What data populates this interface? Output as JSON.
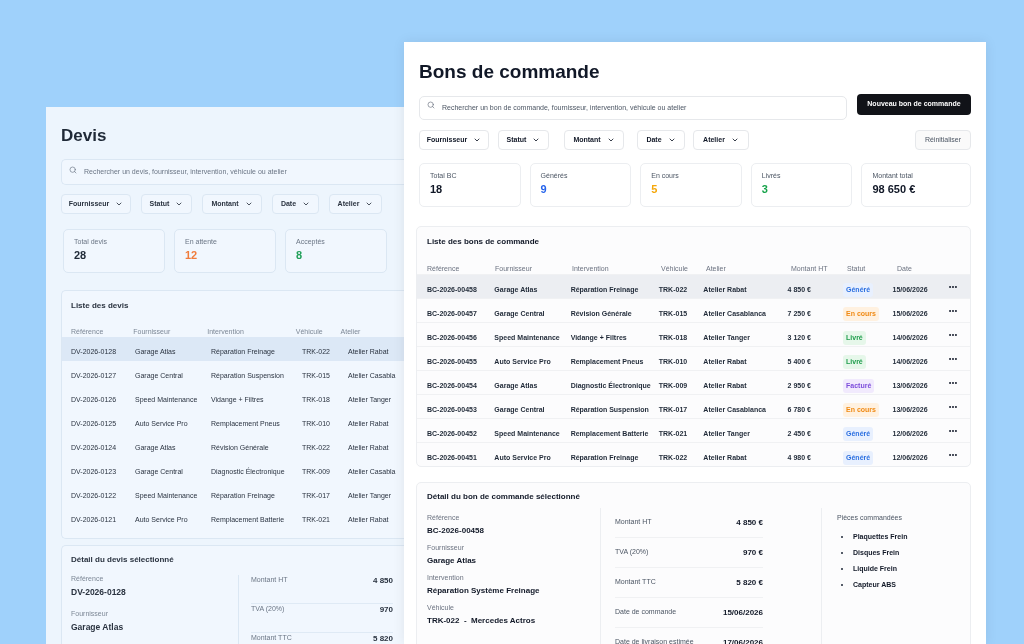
{
  "devis_window": {
    "title": "Devis",
    "search": {
      "placeholder": "Rechercher un devis, fournisseur, intervention, véhicule ou atelier"
    },
    "filters": [
      "Fournisseur",
      "Statut",
      "Montant",
      "Date",
      "Atelier"
    ],
    "stats": [
      {
        "label": "Total devis",
        "value": "28",
        "color": "#1f2937"
      },
      {
        "label": "En attente",
        "value": "12",
        "color": "#f07c3c"
      },
      {
        "label": "Acceptés",
        "value": "8",
        "color": "#22a05a"
      }
    ],
    "list": {
      "title": "Liste des devis",
      "columns": [
        "Référence",
        "Fournisseur",
        "Intervention",
        "Véhicule",
        "Atelier"
      ],
      "rows": [
        {
          "selected": true,
          "cells": [
            "DV-2026-0128",
            "Garage Atlas",
            "Réparation Freinage",
            "TRK-022",
            "Atelier Rabat"
          ]
        },
        {
          "selected": false,
          "cells": [
            "DV-2026-0127",
            "Garage Central",
            "Réparation Suspension",
            "TRK-015",
            "Atelier Casabla"
          ]
        },
        {
          "selected": false,
          "cells": [
            "DV-2026-0126",
            "Speed Maintenance",
            "Vidange + Filtres",
            "TRK-018",
            "Atelier Tanger"
          ]
        },
        {
          "selected": false,
          "cells": [
            "DV-2026-0125",
            "Auto Service Pro",
            "Remplacement Pneus",
            "TRK-010",
            "Atelier Rabat"
          ]
        },
        {
          "selected": false,
          "cells": [
            "DV-2026-0124",
            "Garage Atlas",
            "Révision Générale",
            "TRK-022",
            "Atelier Rabat"
          ]
        },
        {
          "selected": false,
          "cells": [
            "DV-2026-0123",
            "Garage Central",
            "Diagnostic Électronique",
            "TRK-009",
            "Atelier Casabla"
          ]
        },
        {
          "selected": false,
          "cells": [
            "DV-2026-0122",
            "Speed Maintenance",
            "Réparation Freinage",
            "TRK-017",
            "Atelier Tanger"
          ]
        },
        {
          "selected": false,
          "cells": [
            "DV-2026-0121",
            "Auto Service Pro",
            "Remplacement Batterie",
            "TRK-021",
            "Atelier Rabat"
          ]
        }
      ]
    },
    "detail": {
      "title": "Détail du devis sélectionné",
      "fields": [
        {
          "label": "Référence",
          "value": "DV-2026-0128"
        },
        {
          "label": "Fournisseur",
          "value": "Garage Atlas"
        }
      ],
      "amounts": [
        {
          "label": "Montant HT",
          "value": "4 850"
        },
        {
          "label": "TVA (20%)",
          "value": "970"
        },
        {
          "label": "Montant TTC",
          "value": "5 820"
        }
      ]
    }
  },
  "orders_window": {
    "title": "Bons de commande",
    "search": {
      "placeholder": "Rechercher un bon de commande, fournisseur, intervention, véhicule ou atelier"
    },
    "new_button": "Nouveau bon de commande",
    "filters": [
      "Fournisseur",
      "Statut",
      "Montant",
      "Date",
      "Atelier"
    ],
    "reset_button": "Réinitialiser",
    "stats": [
      {
        "label": "Total BC",
        "value": "18",
        "color": "#111827"
      },
      {
        "label": "Générés",
        "value": "9",
        "color": "#2563eb"
      },
      {
        "label": "En cours",
        "value": "5",
        "color": "#f5a70a"
      },
      {
        "label": "Livrés",
        "value": "3",
        "color": "#16a34a"
      },
      {
        "label": "Montant total",
        "value": "98 650 €",
        "color": "#111827"
      }
    ],
    "list": {
      "title": "Liste des bons de commande",
      "columns": [
        "Référence",
        "Fournisseur",
        "Intervention",
        "Véhicule",
        "Atelier",
        "Montant HT",
        "Statut",
        "Date"
      ],
      "rows": [
        {
          "selected": true,
          "cells": [
            "BC-2026-00458",
            "Garage Atlas",
            "Réparation Freinage",
            "TRK-022",
            "Atelier Rabat",
            "4 850 €"
          ],
          "status": {
            "label": "Généré",
            "kind": "generated"
          },
          "date": "15/06/2026"
        },
        {
          "selected": false,
          "cells": [
            "BC-2026-00457",
            "Garage Central",
            "Révision Générale",
            "TRK-015",
            "Atelier Casablanca",
            "7 250 €"
          ],
          "status": {
            "label": "En cours",
            "kind": "in_progress"
          },
          "date": "15/06/2026"
        },
        {
          "selected": false,
          "cells": [
            "BC-2026-00456",
            "Speed Maintenance",
            "Vidange + Filtres",
            "TRK-018",
            "Atelier Tanger",
            "3 120 €"
          ],
          "status": {
            "label": "Livré",
            "kind": "delivered"
          },
          "date": "14/06/2026"
        },
        {
          "selected": false,
          "cells": [
            "BC-2026-00455",
            "Auto Service Pro",
            "Remplacement Pneus",
            "TRK-010",
            "Atelier Rabat",
            "5 400 €"
          ],
          "status": {
            "label": "Livré",
            "kind": "delivered"
          },
          "date": "14/06/2026"
        },
        {
          "selected": false,
          "cells": [
            "BC-2026-00454",
            "Garage Atlas",
            "Diagnostic Électronique",
            "TRK-009",
            "Atelier Rabat",
            "2 950 €"
          ],
          "status": {
            "label": "Facturé",
            "kind": "invoiced"
          },
          "date": "13/06/2026"
        },
        {
          "selected": false,
          "cells": [
            "BC-2026-00453",
            "Garage Central",
            "Réparation Suspension",
            "TRK-017",
            "Atelier Casablanca",
            "6 780 €"
          ],
          "status": {
            "label": "En cours",
            "kind": "in_progress"
          },
          "date": "13/06/2026"
        },
        {
          "selected": false,
          "cells": [
            "BC-2026-00452",
            "Speed Maintenance",
            "Remplacement Batterie",
            "TRK-021",
            "Atelier Tanger",
            "2 450 €"
          ],
          "status": {
            "label": "Généré",
            "kind": "generated"
          },
          "date": "12/06/2026"
        },
        {
          "selected": false,
          "cells": [
            "BC-2026-00451",
            "Auto Service Pro",
            "Réparation Freinage",
            "TRK-022",
            "Atelier Rabat",
            "4 980 €"
          ],
          "status": {
            "label": "Généré",
            "kind": "generated"
          },
          "date": "12/06/2026"
        }
      ]
    },
    "detail": {
      "title": "Détail du bon de commande sélectionné",
      "fields": [
        {
          "label": "Référence",
          "value": "BC-2026-00458"
        },
        {
          "label": "Fournisseur",
          "value": "Garage Atlas"
        },
        {
          "label": "Intervention",
          "value": "Réparation Système Freinage"
        },
        {
          "label": "Véhicule",
          "value": "TRK-022  -  Mercedes Actros"
        }
      ],
      "amounts": [
        {
          "label": "Montant HT",
          "value": "4 850 €"
        },
        {
          "label": "TVA (20%)",
          "value": "970 €"
        },
        {
          "label": "Montant TTC",
          "value": "5 820 €"
        },
        {
          "label": "Date de commande",
          "value": "15/06/2026"
        },
        {
          "label": "Date de livraison estimée",
          "value": "17/06/2026"
        }
      ],
      "parts": {
        "title": "Pièces commandées",
        "items": [
          "Plaquettes Frein",
          "Disques Frein",
          "Liquide Frein",
          "Capteur ABS"
        ]
      }
    }
  }
}
